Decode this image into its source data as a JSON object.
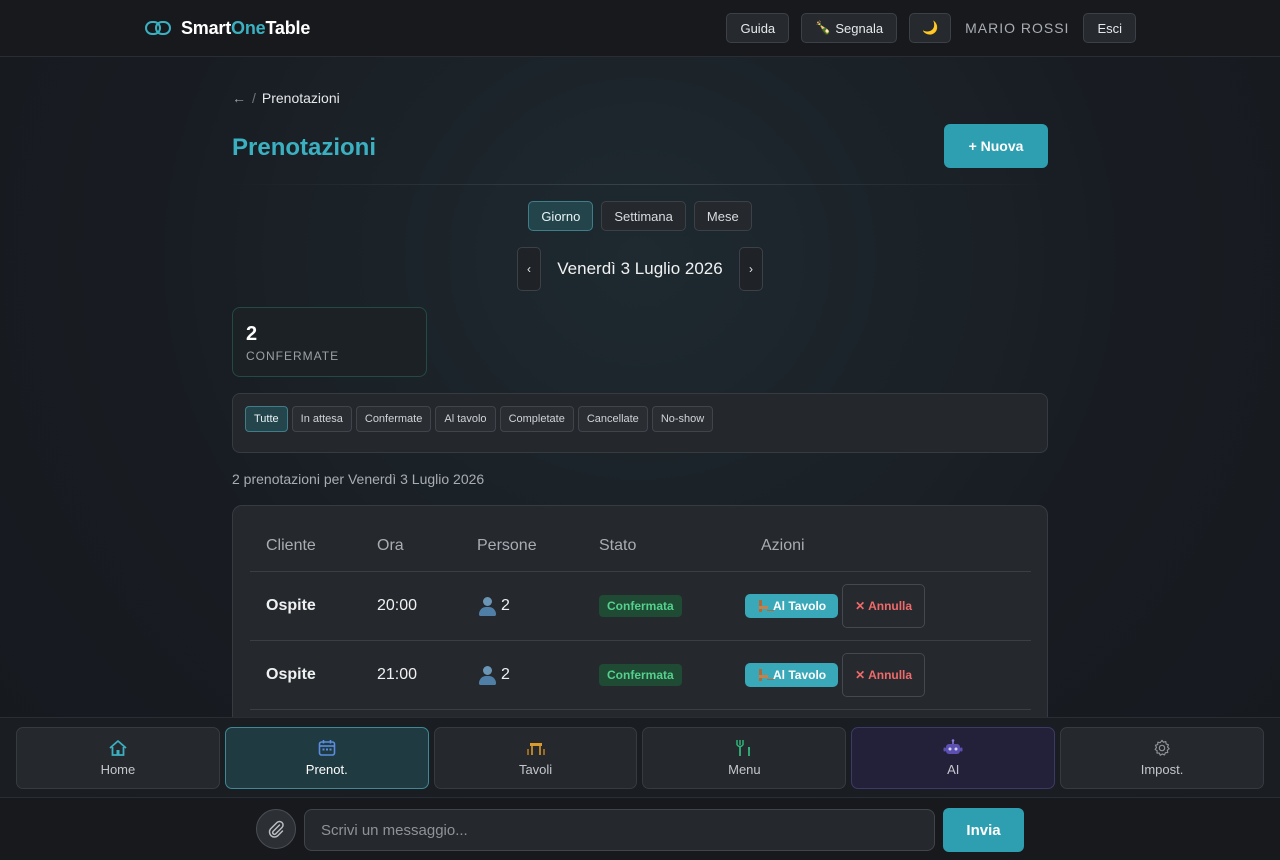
{
  "header": {
    "logo_part1": "Smart",
    "logo_part2": "One",
    "logo_part3": "Table",
    "guide_label": "Guida",
    "report_label": "Segnala",
    "report_icon": "🍾",
    "theme_icon": "🌙",
    "user_name": "MARIO ROSSI",
    "logout_label": "Esci"
  },
  "breadcrumb": {
    "back_icon": "←",
    "separator": "/",
    "current": "Prenotazioni"
  },
  "page": {
    "title": "Prenotazioni",
    "new_button": "+ Nuova"
  },
  "view_tabs": [
    {
      "label": "Giorno",
      "active": true
    },
    {
      "label": "Settimana",
      "active": false
    },
    {
      "label": "Mese",
      "active": false
    }
  ],
  "date_nav": {
    "prev": "‹",
    "next": "›",
    "date": "Venerdì 3 Luglio 2026"
  },
  "stat": {
    "value": "2",
    "label": "CONFERMATE"
  },
  "filters": [
    {
      "label": "Tutte",
      "active": true
    },
    {
      "label": "In attesa",
      "active": false
    },
    {
      "label": "Confermate",
      "active": false
    },
    {
      "label": "Al tavolo",
      "active": false
    },
    {
      "label": "Completate",
      "active": false
    },
    {
      "label": "Cancellate",
      "active": false
    },
    {
      "label": "No-show",
      "active": false
    }
  ],
  "summary": "2 prenotazioni per Venerdì 3 Luglio 2026",
  "table": {
    "headers": [
      "Cliente",
      "Ora",
      "Persone",
      "Stato",
      "Azioni"
    ],
    "rows": [
      {
        "cliente": "Ospite",
        "ora": "20:00",
        "persone": "2",
        "stato": "Confermata",
        "seat_label": "Al Tavolo",
        "cancel_label": "✕ Annulla"
      },
      {
        "cliente": "Ospite",
        "ora": "21:00",
        "persone": "2",
        "stato": "Confermata",
        "seat_label": "Al Tavolo",
        "cancel_label": "✕ Annulla"
      }
    ]
  },
  "bottom_nav": [
    {
      "label": "Home",
      "icon": "home-icon",
      "active": false
    },
    {
      "label": "Prenot.",
      "icon": "calendar-icon",
      "active": true
    },
    {
      "label": "Tavoli",
      "icon": "table-icon",
      "active": false
    },
    {
      "label": "Menu",
      "icon": "cutlery-icon",
      "active": false
    },
    {
      "label": "AI",
      "icon": "robot-icon",
      "active": false
    },
    {
      "label": "Impost.",
      "icon": "gear-icon",
      "active": false
    }
  ],
  "chat": {
    "placeholder": "Scrivi un messaggio...",
    "send_label": "Invia"
  },
  "colors": {
    "accent": "#3bb0c0",
    "status_confirmed": "#54d18c",
    "danger": "#ef6a6a"
  }
}
